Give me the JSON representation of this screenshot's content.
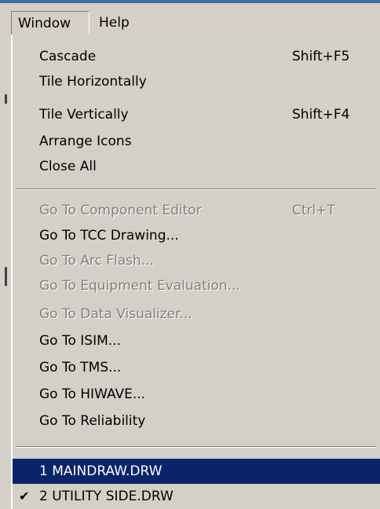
{
  "menubar": {
    "items": [
      {
        "label": "Window"
      },
      {
        "label": "Help"
      }
    ]
  },
  "window_menu": {
    "group1": [
      {
        "label": "Cascade",
        "shortcut": "Shift+F5",
        "enabled": true
      },
      {
        "label": "Tile Horizontally",
        "shortcut": "",
        "enabled": true
      },
      {
        "label": "Tile Vertically",
        "shortcut": "Shift+F4",
        "enabled": true
      },
      {
        "label": "Arrange Icons",
        "shortcut": "",
        "enabled": true
      },
      {
        "label": "Close All",
        "shortcut": "",
        "enabled": true
      }
    ],
    "group2": [
      {
        "label": "Go To Component Editor",
        "shortcut": "Ctrl+T",
        "enabled": false
      },
      {
        "label": "Go To TCC Drawing...",
        "shortcut": "",
        "enabled": true
      },
      {
        "label": "Go To Arc Flash...",
        "shortcut": "",
        "enabled": false
      },
      {
        "label": "Go To Equipment Evaluation...",
        "shortcut": "",
        "enabled": false
      },
      {
        "label": "Go To Data Visualizer...",
        "shortcut": "",
        "enabled": false
      },
      {
        "label": "Go To ISIM...",
        "shortcut": "",
        "enabled": true
      },
      {
        "label": "Go To TMS...",
        "shortcut": "",
        "enabled": true
      },
      {
        "label": "Go To HIWAVE...",
        "shortcut": "",
        "enabled": true
      },
      {
        "label": "Go To Reliability",
        "shortcut": "",
        "enabled": true
      }
    ],
    "group3": [
      {
        "label": "1 MAINDRAW.DRW",
        "highlighted": true,
        "checked": false
      },
      {
        "label": "2 UTILITY SIDE.DRW",
        "highlighted": false,
        "checked": true
      }
    ]
  },
  "colors": {
    "menu_bg": "#d4d0c8",
    "highlight_bg": "#0a246a",
    "highlight_text": "#ffffff",
    "disabled_text": "#808080"
  },
  "icons": {
    "check": "check-mark-icon"
  }
}
